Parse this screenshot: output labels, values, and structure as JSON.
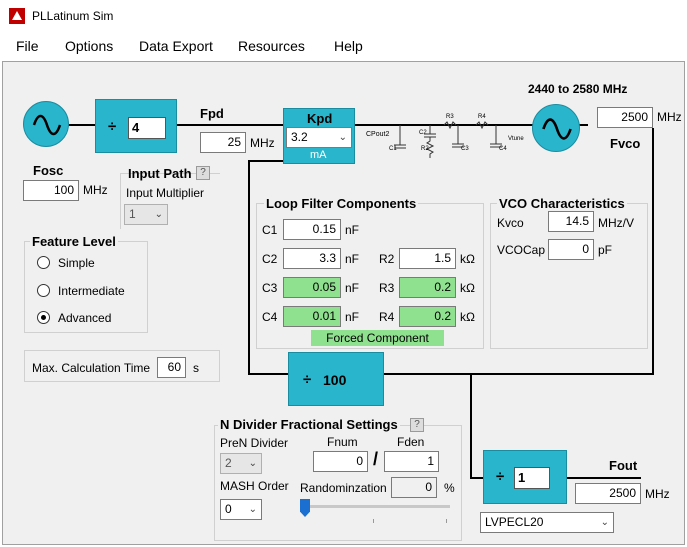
{
  "window": {
    "title": "PLLatinum Sim"
  },
  "menu": [
    "File",
    "Options",
    "Data Export",
    "Resources",
    "Help"
  ],
  "osc": {
    "label": "Fosc",
    "value": "100",
    "unit": "MHz"
  },
  "r_divider": {
    "symbol": "÷",
    "value": "4"
  },
  "fpd": {
    "label": "Fpd",
    "value": "25",
    "unit": "MHz"
  },
  "input_path": {
    "title": "Input Path",
    "help": "?",
    "mult_label": "Input Multiplier",
    "mult_value": "1"
  },
  "kpd": {
    "label": "Kpd",
    "value": "3.2",
    "unit": "mA"
  },
  "schematic": {
    "cpout": "CPout2",
    "c1": "C1",
    "c2": "C2",
    "c3": "C3",
    "c4": "C4",
    "r2": "R2",
    "r3": "R3",
    "r4": "R4",
    "vtune": "Vtune"
  },
  "vco": {
    "range": "2440 to 2580 MHz",
    "value": "2500",
    "unit": "MHz",
    "label": "Fvco"
  },
  "feature_level": {
    "title": "Feature Level",
    "options": [
      "Simple",
      "Intermediate",
      "Advanced"
    ],
    "selected": "Advanced"
  },
  "max_calc": {
    "label": "Max. Calculation Time",
    "value": "60",
    "unit": "s"
  },
  "loop_filter": {
    "title": "Loop Filter Components",
    "c1": {
      "label": "C1",
      "value": "0.15",
      "unit": "nF"
    },
    "c2": {
      "label": "C2",
      "value": "3.3",
      "unit": "nF"
    },
    "c3": {
      "label": "C3",
      "value": "0.05",
      "unit": "nF"
    },
    "c4": {
      "label": "C4",
      "value": "0.01",
      "unit": "nF"
    },
    "r2": {
      "label": "R2",
      "value": "1.5",
      "unit": "kΩ"
    },
    "r3": {
      "label": "R3",
      "value": "0.2",
      "unit": "kΩ"
    },
    "r4": {
      "label": "R4",
      "value": "0.2",
      "unit": "kΩ"
    },
    "forced": "Forced Component"
  },
  "vco_char": {
    "title": "VCO Characteristics",
    "kvco_label": "Kvco",
    "kvco_value": "14.5",
    "kvco_unit": "MHz/V",
    "vcocap_label": "VCOCap",
    "vcocap_value": "0",
    "vcocap_unit": "pF"
  },
  "n_divider": {
    "symbol": "÷",
    "value": "100"
  },
  "frac": {
    "title": "N Divider Fractional Settings",
    "help": "?",
    "preN_label": "PreN Divider",
    "preN_value": "2",
    "fnum_label": "Fnum",
    "fnum_value": "0",
    "fden_label": "Fden",
    "fden_value": "1",
    "slash": "/",
    "mash_label": "MASH Order",
    "mash_value": "0",
    "rand_label": "Randominzation",
    "rand_value": "0",
    "rand_unit": "%",
    "slider_fraction": 0.0
  },
  "out_divider": {
    "symbol": "÷",
    "value": "1"
  },
  "fout": {
    "label": "Fout",
    "value": "2500",
    "unit": "MHz",
    "format": "LVPECL20"
  },
  "colors": {
    "accent": "#29b5cc",
    "forced_green": "#8fe08f"
  }
}
